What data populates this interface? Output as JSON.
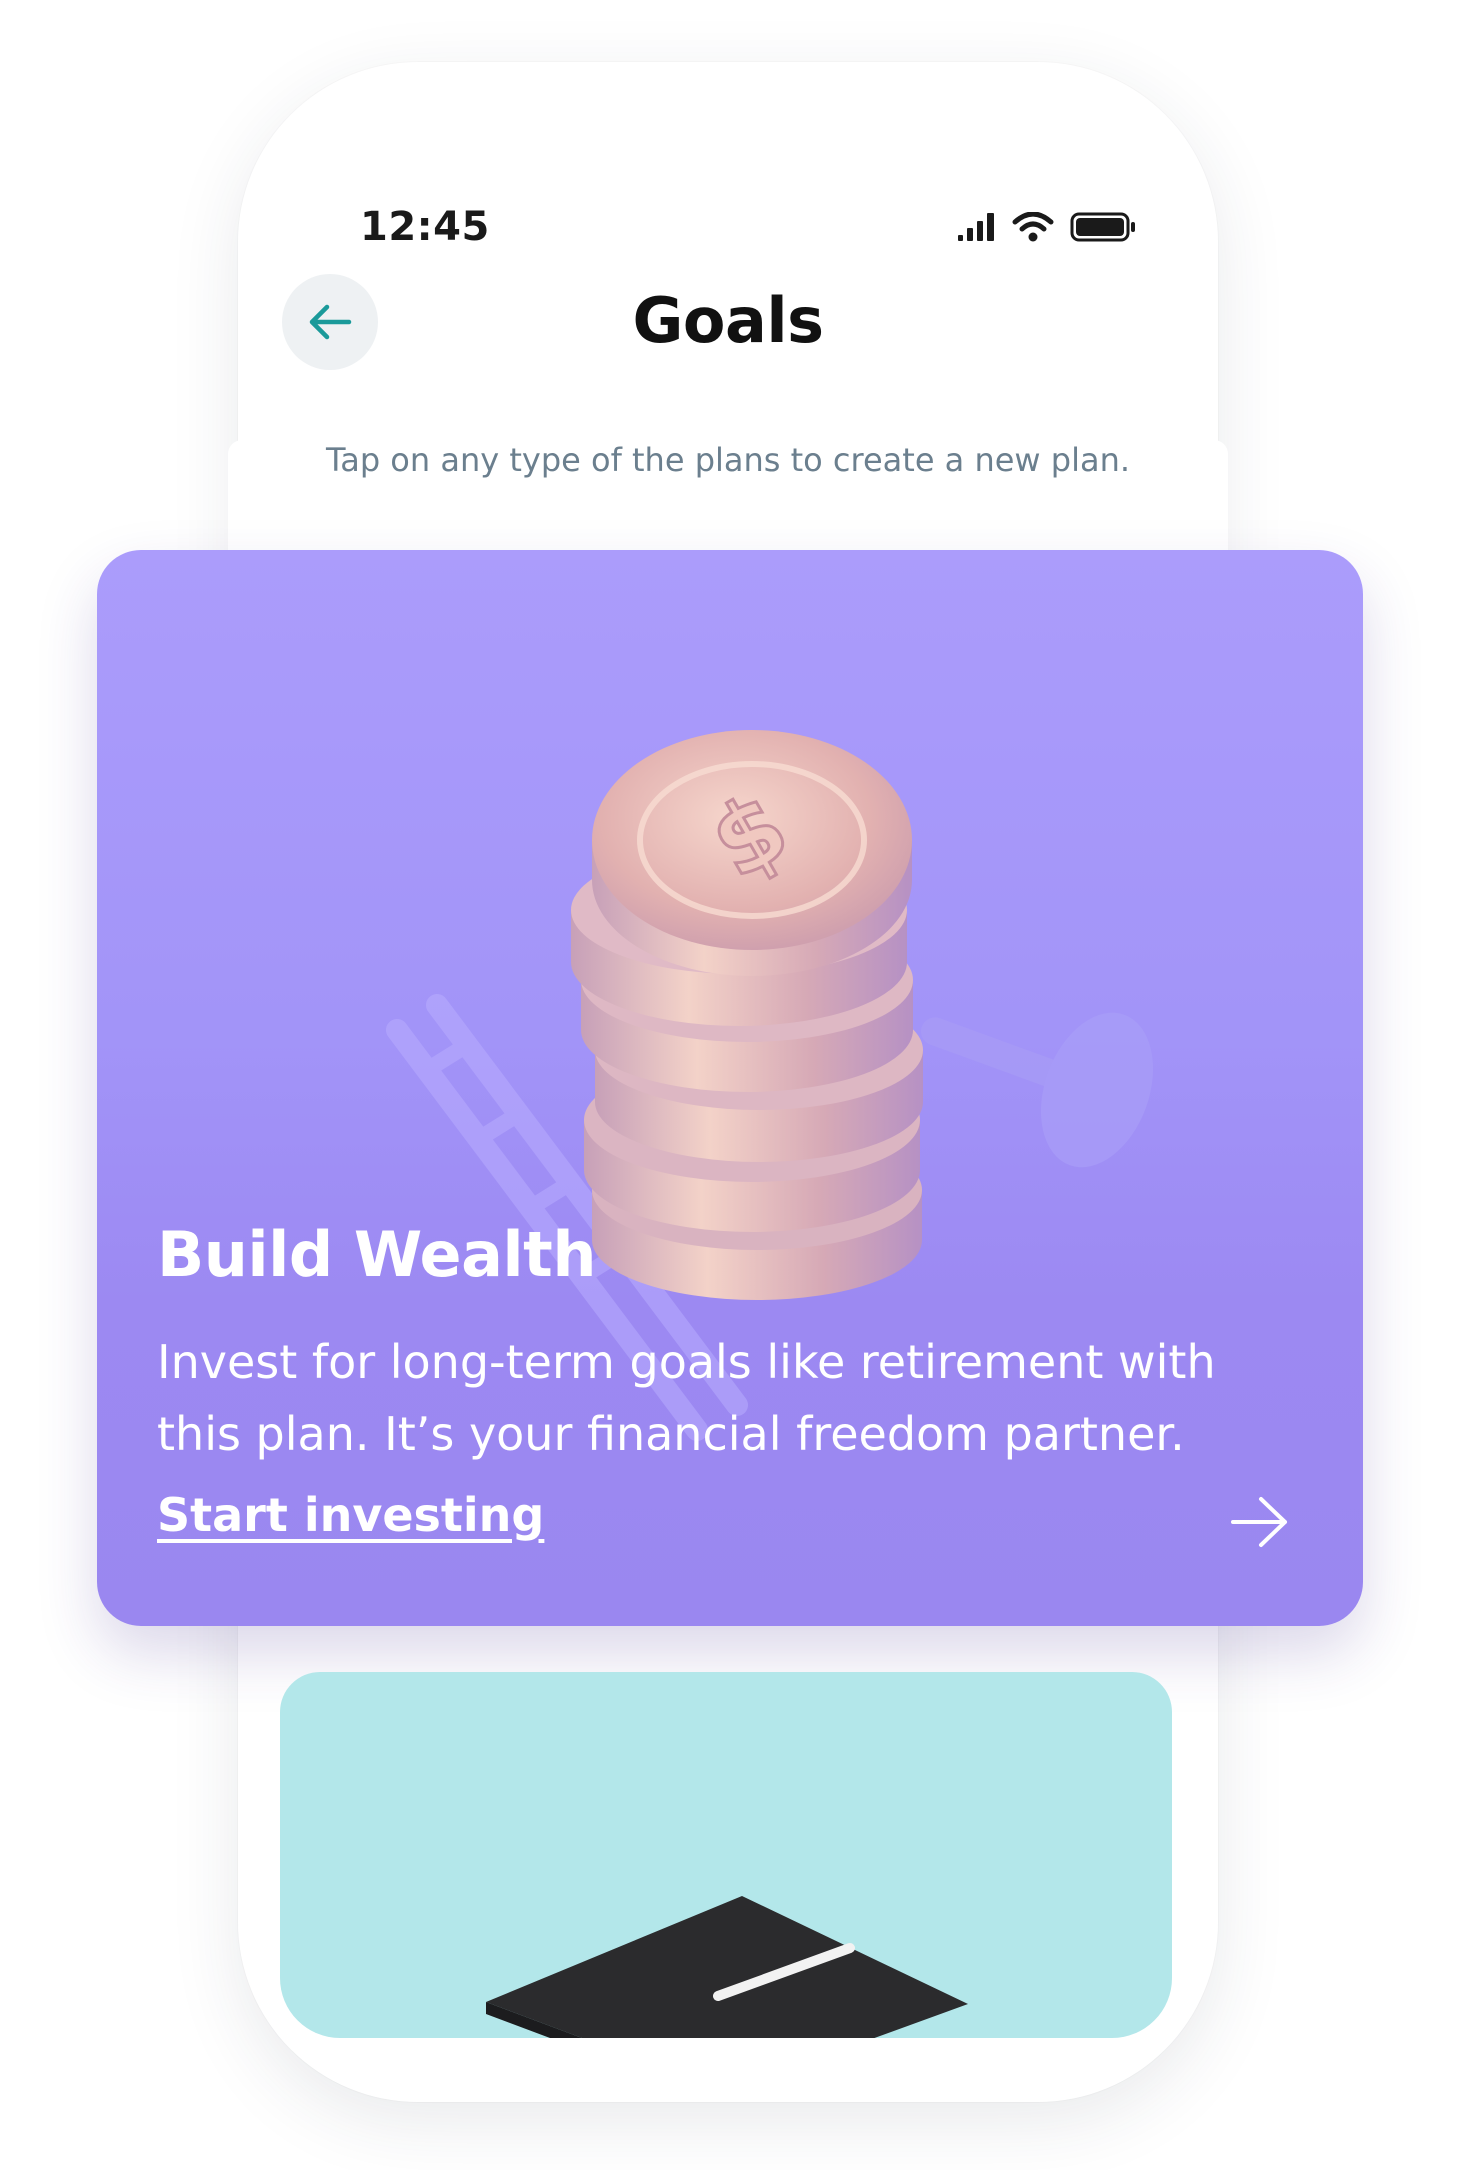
{
  "status_bar": {
    "time": "12:45"
  },
  "header": {
    "title": "Goals",
    "back_icon": "arrow-left-icon"
  },
  "subtitle": "Tap on any type of the plans to create a new plan.",
  "plans": [
    {
      "title": "Build Wealth",
      "description": "Invest for long-term goals like retirement with this plan. It’s your financial freedom partner.",
      "cta": "Start investing",
      "cta_icon": "arrow-right-icon",
      "color": "#a393f7"
    },
    {
      "color": "#b3e7ea"
    }
  ],
  "colors": {
    "accent": "#1a9a9a",
    "text_dark": "#111111",
    "subtitle": "#6b7f8e"
  }
}
